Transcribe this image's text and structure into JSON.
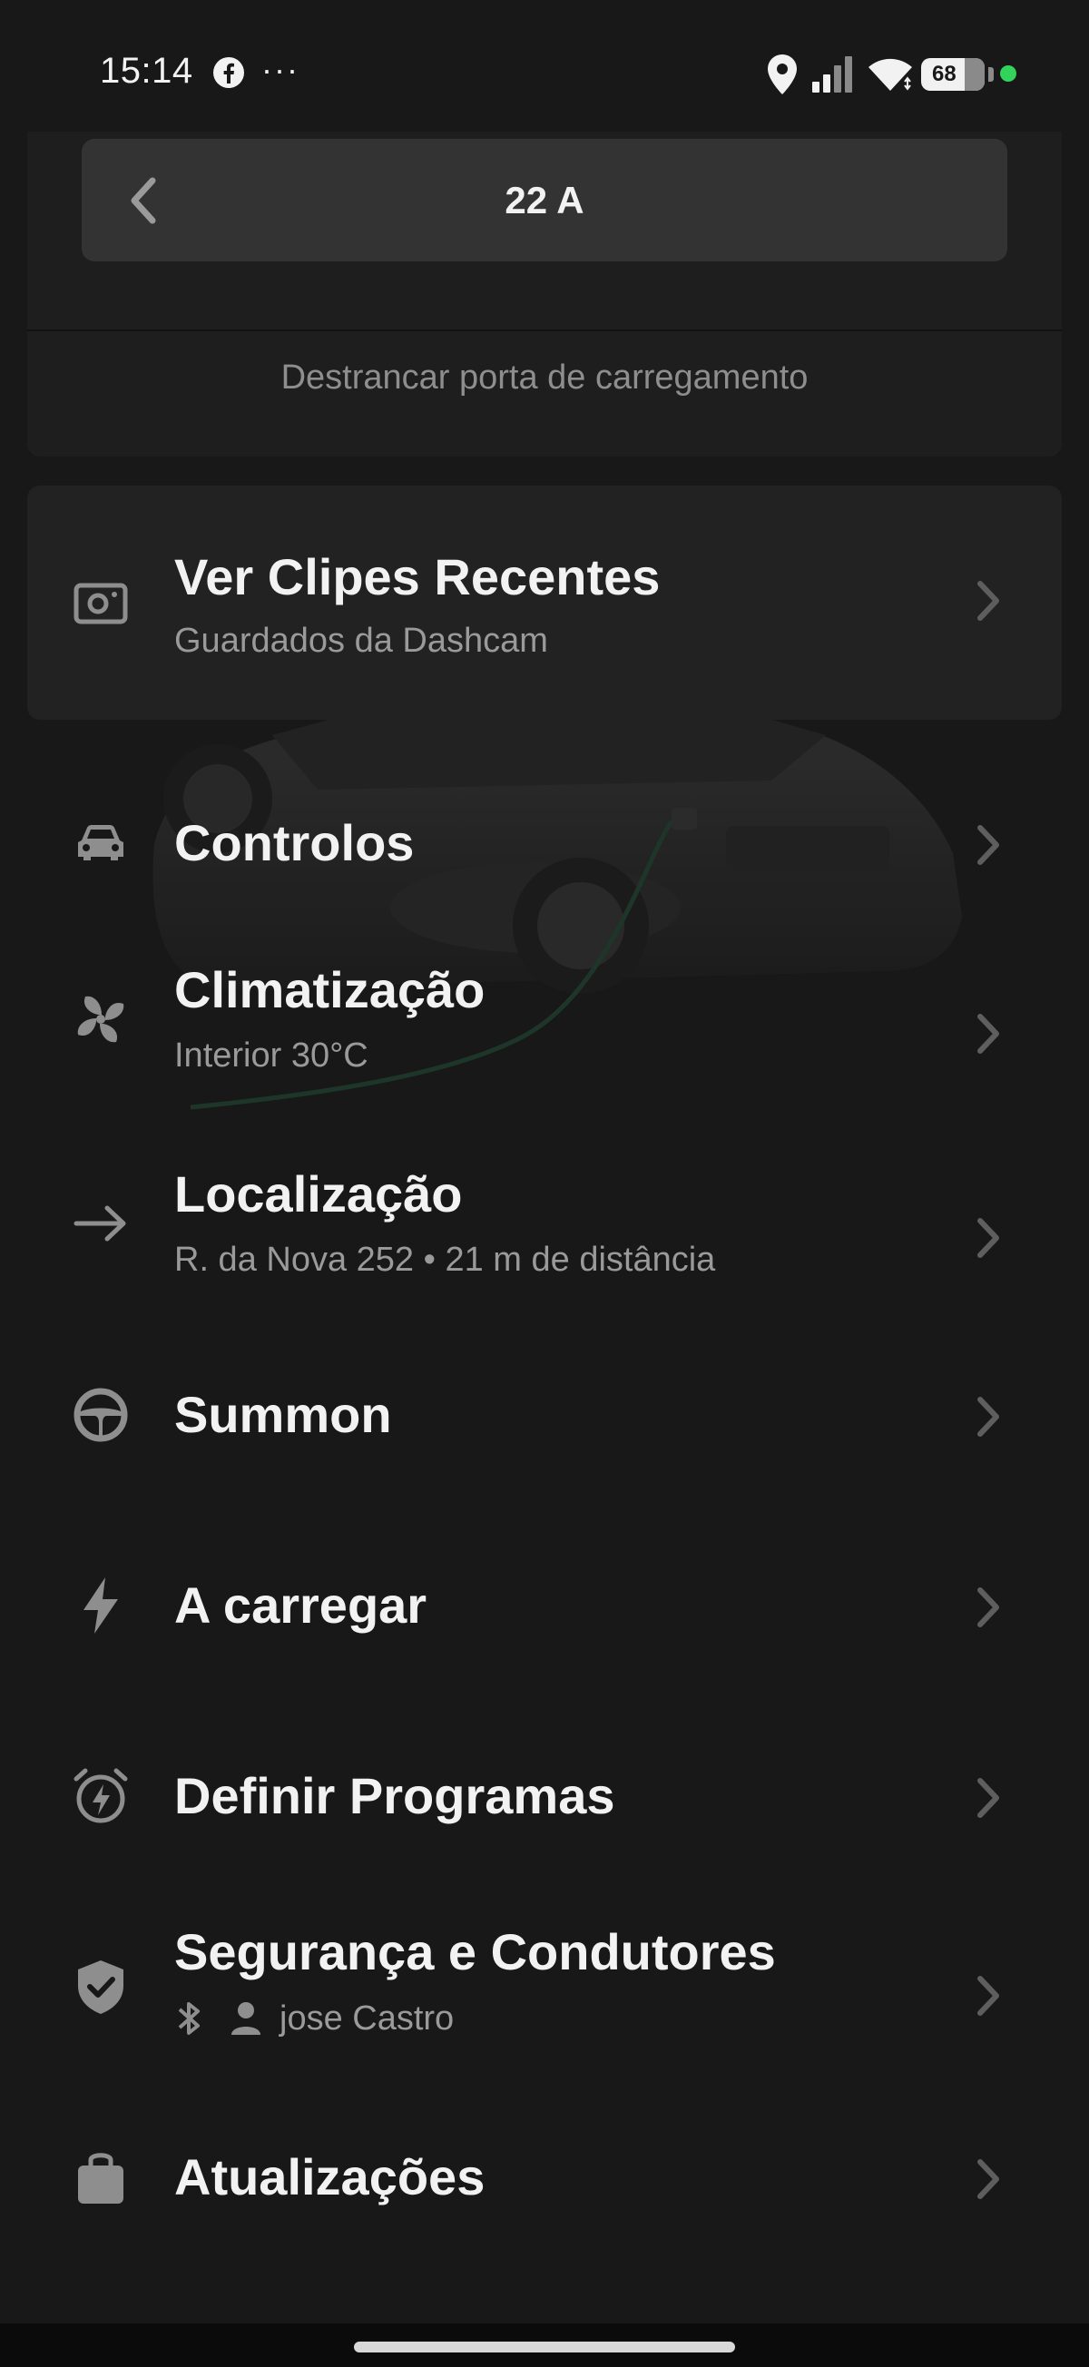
{
  "status_bar": {
    "time": "15:14",
    "battery_level": "68",
    "notification_dots": "···"
  },
  "charging": {
    "amp_value": "22 A",
    "unlock_port_label": "Destrancar porta de carregamento"
  },
  "clips": {
    "title": "Ver Clipes Recentes",
    "subtitle": "Guardados da Dashcam"
  },
  "menu": {
    "controls": {
      "title": "Controlos"
    },
    "climate": {
      "title": "Climatização",
      "subtitle": "Interior 30°C"
    },
    "location": {
      "title": "Localização",
      "subtitle": "R. da Nova 252 • 21 m de distância"
    },
    "summon": {
      "title": "Summon"
    },
    "charging": {
      "title": "A carregar"
    },
    "schedules": {
      "title": "Definir Programas"
    },
    "security": {
      "title": "Segurança e Condutores",
      "driver_name": "jose Castro"
    },
    "updates": {
      "title": "Atualizações"
    }
  },
  "colors": {
    "background": "#181818",
    "card": "#222222",
    "status_dot": "#32d35a"
  }
}
